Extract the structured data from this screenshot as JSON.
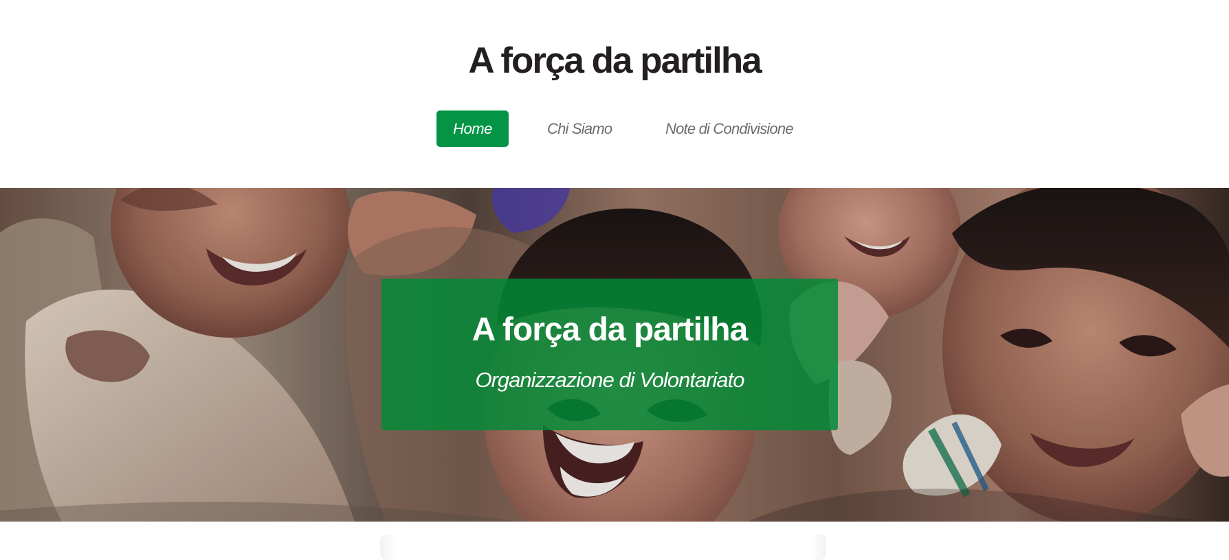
{
  "site": {
    "title": "A força da partilha"
  },
  "nav": {
    "items": [
      {
        "label": "Home",
        "active": true
      },
      {
        "label": "Chi Siamo",
        "active": false
      },
      {
        "label": "Note di Condivisione",
        "active": false
      }
    ]
  },
  "hero": {
    "title": "A força da partilha",
    "subtitle": "Organizzazione di Volontariato",
    "overlay_color": "#008a36",
    "image_subject": "children-smiling-photo"
  },
  "colors": {
    "accent": "#039545",
    "title_text": "#231f20",
    "nav_text": "#6d6d6d",
    "background": "#ffffff"
  }
}
